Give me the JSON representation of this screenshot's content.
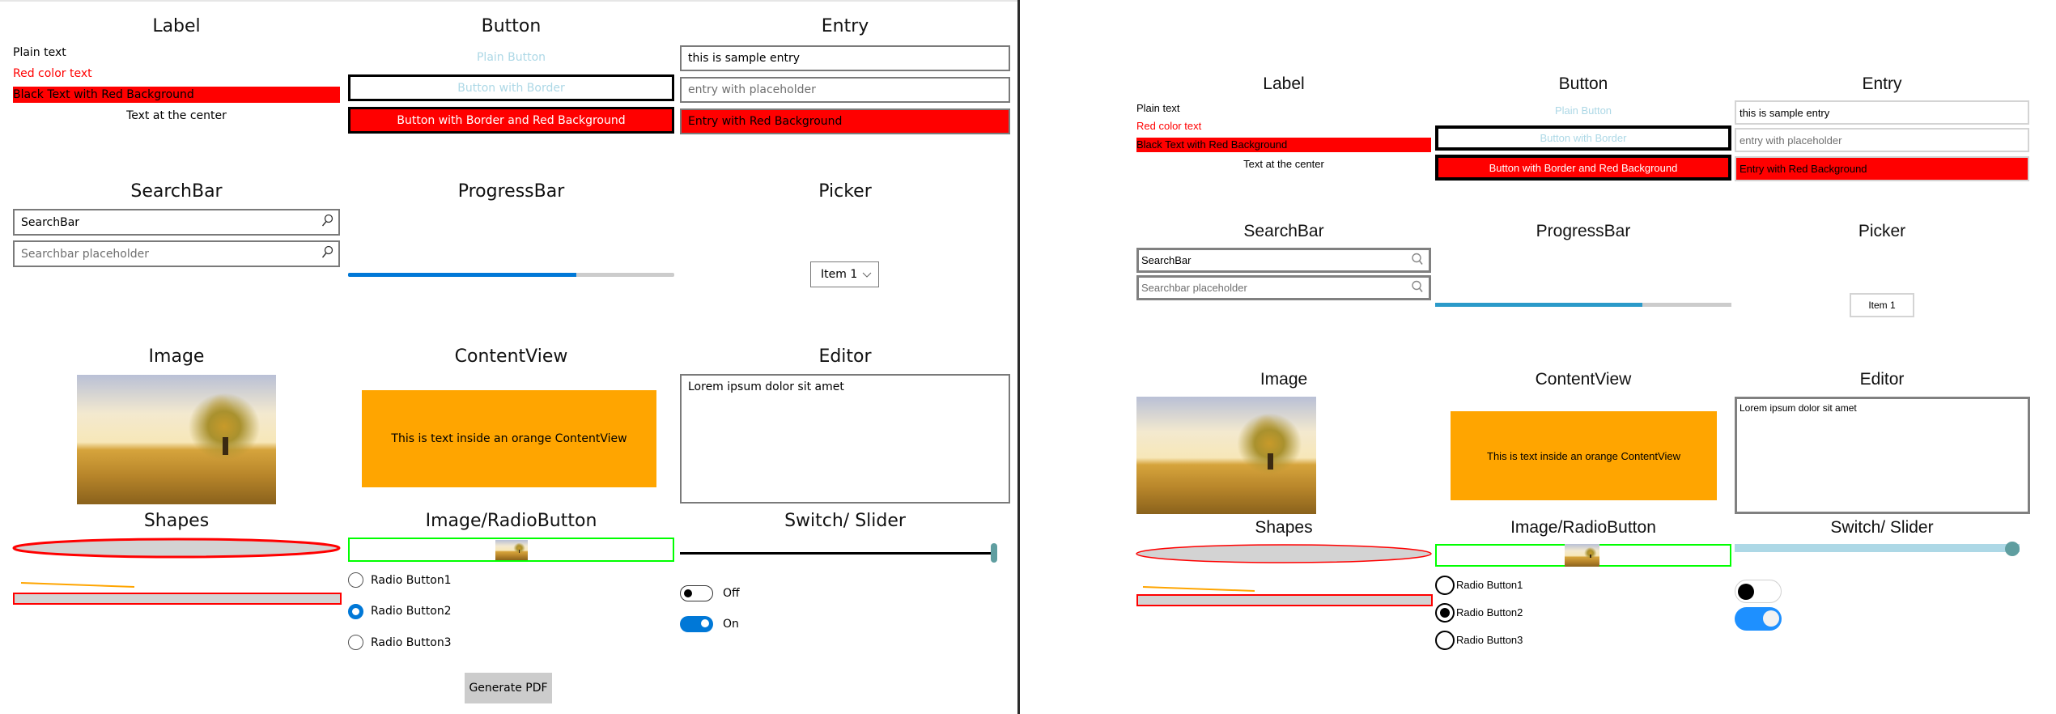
{
  "sections": {
    "label": "Label",
    "button": "Button",
    "entry": "Entry",
    "searchbar": "SearchBar",
    "progressbar": "ProgressBar",
    "picker": "Picker",
    "image": "Image",
    "contentview": "ContentView",
    "editor": "Editor",
    "shapes": "Shapes",
    "image_radio": "Image/RadioButton",
    "switch_slider": "Switch/ Slider"
  },
  "labels": {
    "plain": "Plain text",
    "red": "Red color text",
    "red_bg": "Black Text with Red Background",
    "center": "Text at the center"
  },
  "buttons": {
    "plain": "Plain Button",
    "bordered": "Button with Border",
    "bordered_red": "Button with Border and Red Background",
    "generate_pdf": "Generate PDF"
  },
  "entries": {
    "sample_value": "this is sample entry",
    "placeholder": "entry with placeholder",
    "red_bg_value": "Entry with Red Background"
  },
  "searchbars": {
    "value": "SearchBar",
    "placeholder": "Searchbar placeholder"
  },
  "progress": {
    "value": 0.7
  },
  "picker": {
    "selected": "Item 1"
  },
  "contentview": {
    "text": "This is text inside an orange ContentView"
  },
  "editor": {
    "text": "Lorem ipsum dolor sit amet"
  },
  "radios": [
    {
      "label": "Radio Button1",
      "checked": false
    },
    {
      "label": "Radio Button2",
      "checked": true
    },
    {
      "label": "Radio Button3",
      "checked": false
    }
  ],
  "slider": {
    "value": 1.0
  },
  "switches": [
    {
      "label": "Off",
      "on": false
    },
    {
      "label": "On",
      "on": true
    }
  ],
  "colors": {
    "red": "#ff0000",
    "light_blue_text": "#add8e6",
    "orange": "#ffa500",
    "green_border": "#00ff00",
    "accent_native": "#0078d7",
    "accent_pdf_switch": "#1e90ff",
    "progress_pdf": "#2b9ac9",
    "slider_thumb": "#5f9ea0",
    "slider_track_pdf": "#add8e6"
  }
}
